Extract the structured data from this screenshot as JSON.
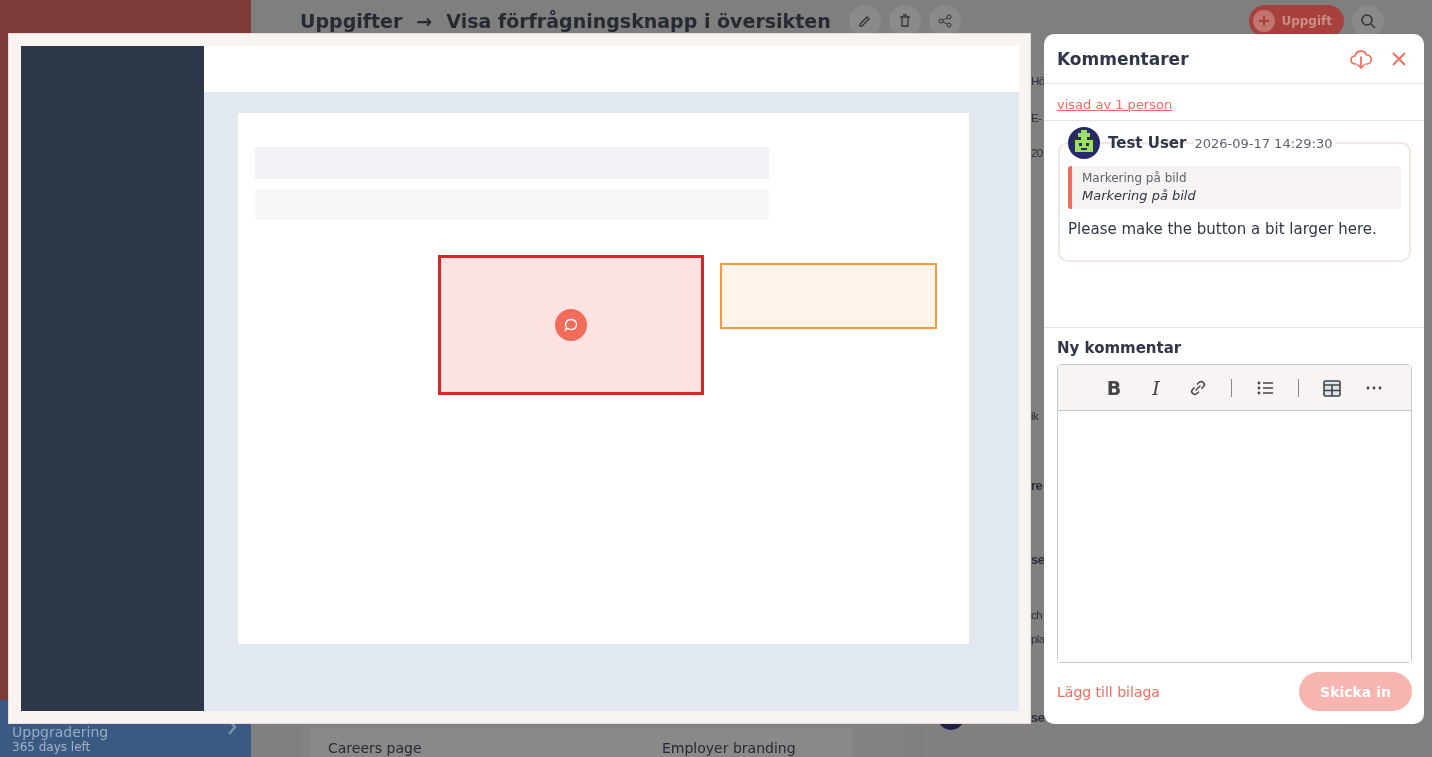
{
  "background_page": {
    "sidebar": {
      "upgrade_title": "Uppgradering",
      "days_left": "365 days left"
    },
    "header": {
      "breadcrumb": "Uppgifter",
      "separator": "→",
      "title": "Visa förfrågningsknapp i översikten",
      "new_task_button": "Uppgift"
    },
    "table_row": {
      "column_1": "Careers page",
      "column_2": "Employer branding"
    },
    "details_fragments": [
      {
        "text": "Hö",
        "bold": false
      },
      {
        "text": "E-",
        "bold": false
      },
      {
        "text": "20",
        "bold": false
      },
      {
        "text": "ik",
        "bold": false
      },
      {
        "text": "re",
        "bold": true
      },
      {
        "text": "se",
        "bold": true
      },
      {
        "text": "ch",
        "bold": false
      },
      {
        "text": "pla",
        "bold": false
      },
      {
        "text": "se",
        "bold": true
      }
    ]
  },
  "image_viewer": {
    "annotations": [
      {
        "kind": "marking",
        "color": "#dc2626",
        "has_comment": true
      },
      {
        "kind": "marking",
        "color": "#f6993f",
        "has_comment": false
      }
    ]
  },
  "comments_panel": {
    "title": "Kommentarer",
    "viewed_by_link": "visad av 1 person",
    "comments": [
      {
        "author": "Test User",
        "timestamp": "2026-09-17 14:29:30",
        "quote_label": "Markering på bild",
        "quote_text": "Markering på bild",
        "body": "Please make the button a bit larger here."
      }
    ],
    "new_comment": {
      "title": "Ny kommentar",
      "toolbar": [
        {
          "kind": "bold",
          "label": "B"
        },
        {
          "kind": "italic",
          "label": "I"
        },
        {
          "kind": "link"
        },
        {
          "kind": "separator"
        },
        {
          "kind": "list"
        },
        {
          "kind": "separator"
        },
        {
          "kind": "table"
        },
        {
          "kind": "more"
        }
      ],
      "attach_link": "Lägg till bilaga",
      "submit": {
        "label": "Skicka in",
        "disabled": true
      }
    }
  }
}
